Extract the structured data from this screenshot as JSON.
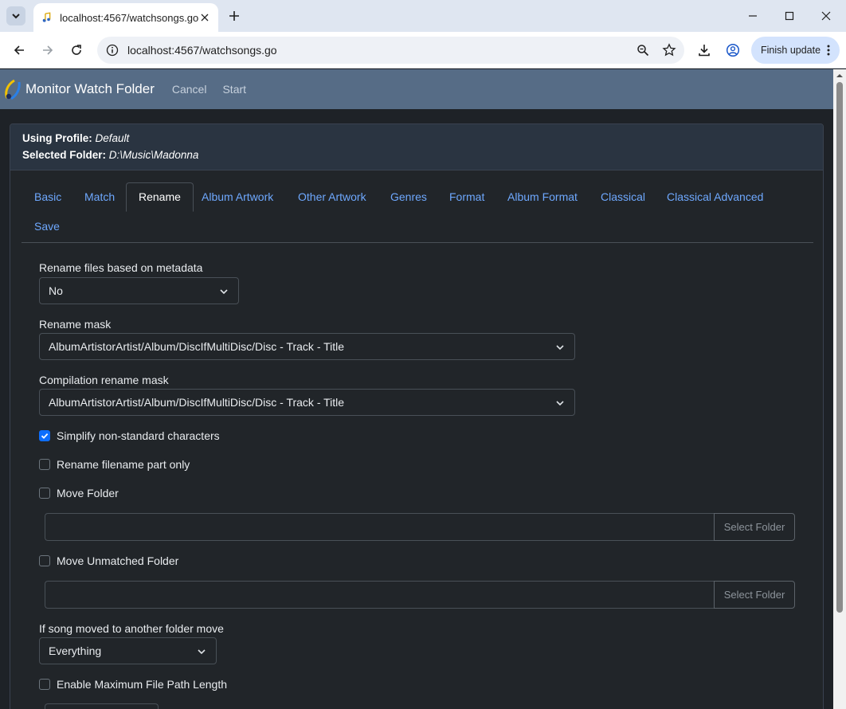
{
  "browser": {
    "tab_title": "localhost:4567/watchsongs.go",
    "url": "localhost:4567/watchsongs.go",
    "finish_update_label": "Finish update"
  },
  "app": {
    "title": "Monitor Watch Folder",
    "cancel_label": "Cancel",
    "start_label": "Start"
  },
  "panel": {
    "profile_label": "Using Profile:",
    "profile_value": "Default",
    "folder_label": "Selected Folder:",
    "folder_value": "D:\\Music\\Madonna"
  },
  "tabs": {
    "basic": "Basic",
    "match": "Match",
    "rename": "Rename",
    "album_artwork": "Album Artwork",
    "other_artwork": "Other Artwork",
    "genres": "Genres",
    "format": "Format",
    "album_format": "Album Format",
    "classical": "Classical",
    "classical_advanced": "Classical Advanced",
    "save": "Save",
    "active": "Rename"
  },
  "form": {
    "rename_files_label": "Rename files based on metadata",
    "rename_files_value": "No",
    "rename_mask_label": "Rename mask",
    "rename_mask_value": "AlbumArtistorArtist/Album/DiscIfMultiDisc/Disc - Track - Title",
    "compilation_mask_label": "Compilation rename mask",
    "compilation_mask_value": "AlbumArtistorArtist/Album/DiscIfMultiDisc/Disc - Track - Title",
    "simplify_label": "Simplify non-standard characters",
    "simplify_checked": true,
    "rename_part_label": "Rename filename part only",
    "rename_part_checked": false,
    "move_folder_label": "Move Folder",
    "move_folder_checked": false,
    "move_folder_value": "",
    "select_folder_label": "Select Folder",
    "move_unmatched_label": "Move Unmatched Folder",
    "move_unmatched_checked": false,
    "move_unmatched_value": "",
    "select_folder_label_2": "Select Folder",
    "moved_label": "If song moved to another folder move",
    "moved_value": "Everything",
    "max_path_label": "Enable Maximum File Path Length",
    "max_path_checked": false
  },
  "colors": {
    "app_bar": "#566c86",
    "panel_bg": "#212529",
    "link": "#6ea8fe",
    "checkbox_on": "#0d6efd"
  }
}
